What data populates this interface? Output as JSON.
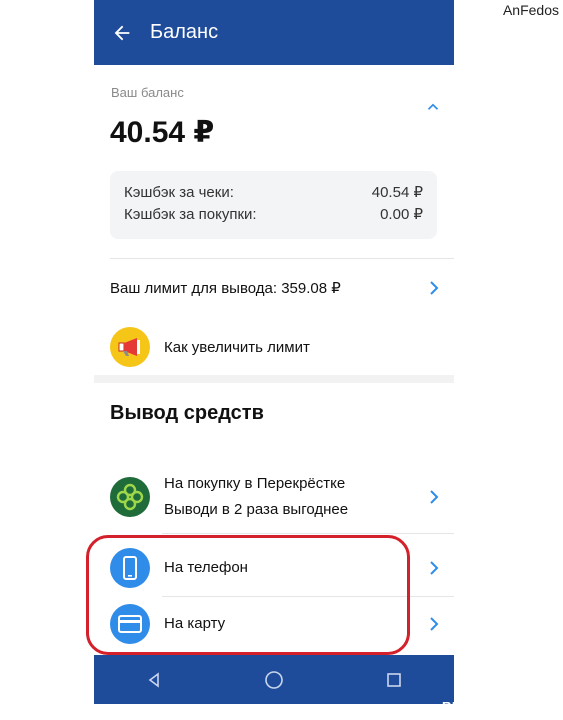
{
  "watermark": {
    "author": "AnFedos",
    "site": "RECOMMEND.RU"
  },
  "appbar": {
    "title": "Баланс",
    "back_icon": "arrow-left-icon"
  },
  "balance": {
    "label": "Ваш баланс",
    "value": "40.54 ₽",
    "cashback": [
      {
        "label": "Кэшбэк за чеки:",
        "value": "40.54 ₽"
      },
      {
        "label": "Кэшбэк за покупки:",
        "value": "0.00 ₽"
      }
    ]
  },
  "limit": {
    "text": "Ваш лимит для вывода: 359.08 ₽"
  },
  "increase": {
    "text": "Как увеличить лимит",
    "icon": "megaphone-icon"
  },
  "withdraw": {
    "title": "Вывод средств",
    "items": [
      {
        "line1": "На покупку в Перекрёстке",
        "line2": "Выводи в 2 раза выгоднее",
        "icon": "perekrestok-logo-icon"
      },
      {
        "line1": "На телефон",
        "icon": "phone-icon"
      },
      {
        "line1": "На карту",
        "icon": "card-icon"
      }
    ]
  },
  "colors": {
    "appbar": "#1f4c9a",
    "accent": "#2f8ce8",
    "highlight": "#d4202a",
    "promo": "#f5c518"
  },
  "navbar": {
    "icons": [
      "nav-back-icon",
      "nav-home-icon",
      "nav-recents-icon"
    ]
  }
}
